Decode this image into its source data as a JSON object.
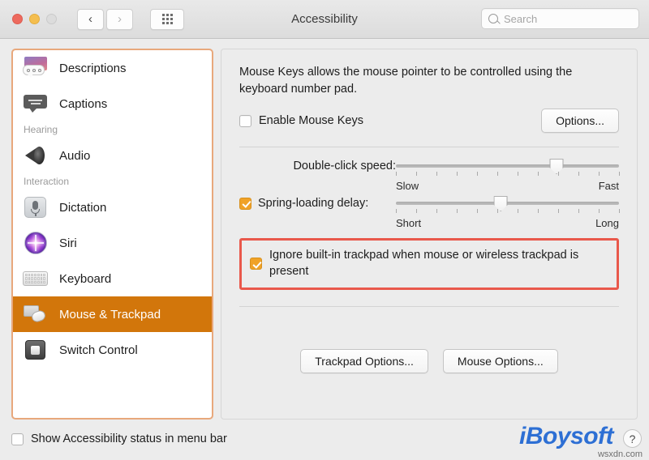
{
  "window": {
    "title": "Accessibility",
    "traffic_lights": [
      "close",
      "minimize",
      "zoom"
    ]
  },
  "toolbar": {
    "back_icon": "‹",
    "forward_icon": "›",
    "grid_icon": "show-all-grid-icon",
    "search": {
      "placeholder": "Search",
      "value": "",
      "icon": "search-icon"
    }
  },
  "sidebar": {
    "items": [
      {
        "label": "Descriptions",
        "icon": "descriptions-icon",
        "type": "item",
        "selected": false
      },
      {
        "label": "Captions",
        "icon": "captions-icon",
        "type": "item",
        "selected": false
      },
      {
        "label": "Hearing",
        "type": "group"
      },
      {
        "label": "Audio",
        "icon": "audio-speaker-icon",
        "type": "item",
        "selected": false
      },
      {
        "label": "Interaction",
        "type": "group"
      },
      {
        "label": "Dictation",
        "icon": "dictation-microphone-icon",
        "type": "item",
        "selected": false
      },
      {
        "label": "Siri",
        "icon": "siri-orb-icon",
        "type": "item",
        "selected": false
      },
      {
        "label": "Keyboard",
        "icon": "keyboard-icon",
        "type": "item",
        "selected": false
      },
      {
        "label": "Mouse & Trackpad",
        "icon": "mouse-trackpad-icon",
        "type": "item",
        "selected": true
      },
      {
        "label": "Switch Control",
        "icon": "switch-control-icon",
        "type": "item",
        "selected": false
      }
    ],
    "highlight_color": "#E8A87C",
    "selected_color": "#D2760B"
  },
  "main": {
    "description": "Mouse Keys allows the mouse pointer to be controlled using the keyboard number pad.",
    "enable_mouse_keys": {
      "label": "Enable Mouse Keys",
      "checked": false
    },
    "options_button": "Options...",
    "double_click": {
      "label": "Double-click speed:",
      "min_label": "Slow",
      "max_label": "Fast",
      "value_percent": 72,
      "tick_count": 12
    },
    "spring_loading": {
      "label": "Spring-loading delay:",
      "checked": true,
      "min_label": "Short",
      "max_label": "Long",
      "value_percent": 47,
      "tick_count": 12
    },
    "ignore_trackpad": {
      "label": "Ignore built-in trackpad when mouse or wireless trackpad is present",
      "checked": true,
      "highlight_color": "#E9584B"
    },
    "trackpad_options_button": "Trackpad Options...",
    "mouse_options_button": "Mouse Options..."
  },
  "footer": {
    "show_status": {
      "label": "Show Accessibility status in menu bar",
      "checked": false
    },
    "brand": "iBoysoft",
    "brand_color": "#2D6FD4",
    "help_button": "?",
    "watermark": "wsxdn.com"
  }
}
